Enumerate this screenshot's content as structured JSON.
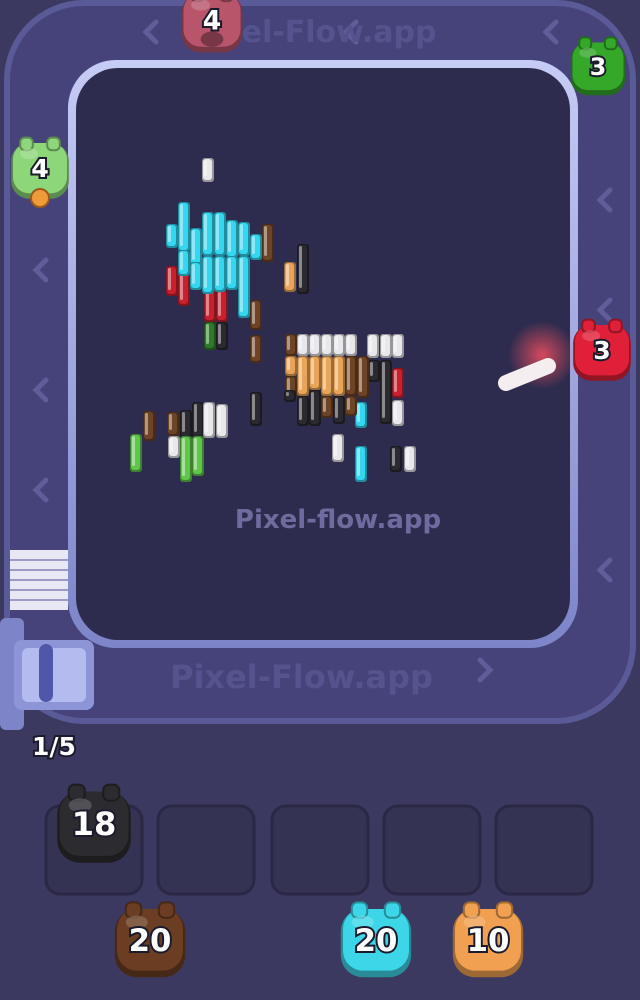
{
  "watermark": {
    "center": "Pixel-flow.app",
    "track_bottom": "Pixel-Flow.app",
    "track_top": "Pixel-Flow.app"
  },
  "progress": {
    "label": "1/5",
    "current": 1,
    "total": 5
  },
  "track_shooters": [
    {
      "color": "#b8556b",
      "count": "4"
    },
    {
      "color": "#35a82a",
      "count": "3"
    },
    {
      "color": "#8ed67a",
      "count": "4"
    },
    {
      "color": "#e02038",
      "count": "3"
    }
  ],
  "queue": [
    {
      "color": "#2c2c30",
      "count": "18"
    },
    {
      "color": "#6b3d22",
      "count": "20"
    },
    {
      "color": "#3dd6e8",
      "count": "20"
    },
    {
      "color": "#f0a050",
      "count": "10"
    }
  ],
  "slots": {
    "count": 5
  },
  "colors": {
    "background": "#3b3960",
    "board": "#2e2c4e",
    "track": "#46437a",
    "track_rail": "#9ea6e8",
    "cyan": "#35d6f0",
    "brown": "#6e4426",
    "white": "#e8e8ec",
    "black": "#2a2a30",
    "green": "#5fc64a",
    "red": "#c8202c",
    "orange": "#e8a55a",
    "dark_green": "#2f7a2a"
  }
}
